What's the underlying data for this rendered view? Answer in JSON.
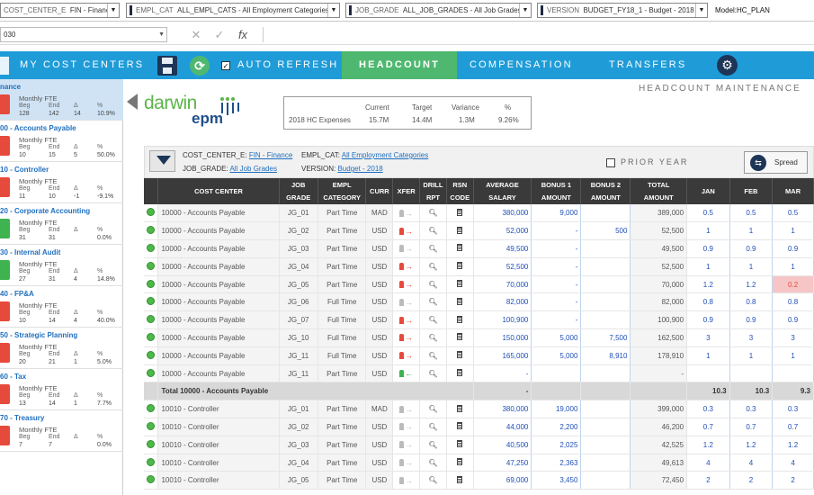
{
  "topbar": {
    "dropdowns": [
      {
        "name": "COST_CENTER_E",
        "value": "FIN - Finance"
      },
      {
        "name": "EMPL_CAT",
        "value": "ALL_EMPL_CATS - All Employment Categories"
      },
      {
        "name": "JOB_GRADE",
        "value": "ALL_JOB_GRADES - All Job Grades"
      },
      {
        "name": "VERSION",
        "value": "BUDGET_FY18_1 - Budget - 2018"
      }
    ],
    "model": "Model:HC_PLAN"
  },
  "formula": {
    "namebox": "030",
    "cancel": "✕",
    "enter": "✓",
    "fx": "fx"
  },
  "nav": {
    "my_cost_centers": "MY COST CENTERS",
    "auto_refresh": "AUTO REFRESH",
    "tabs": [
      "HEADCOUNT",
      "COMPENSATION",
      "TRANSFERS"
    ],
    "active_tab": "HEADCOUNT"
  },
  "sidebar": {
    "items": [
      {
        "title": "nance",
        "beg": "128",
        "end": "142",
        "delta": "14",
        "pct": "10.9%",
        "status": "red",
        "selected": true
      },
      {
        "title": "00 - Accounts Payable",
        "beg": "10",
        "end": "15",
        "delta": "5",
        "pct": "50.0%",
        "status": "red",
        "selected": false
      },
      {
        "title": "10 - Controller",
        "beg": "11",
        "end": "10",
        "delta": "-1",
        "pct": "-9.1%",
        "status": "red",
        "selected": false
      },
      {
        "title": "20 - Corporate Accounting",
        "beg": "31",
        "end": "31",
        "delta": "",
        "pct": "0.0%",
        "status": "green",
        "selected": false
      },
      {
        "title": "30 - Internal Audit",
        "beg": "27",
        "end": "31",
        "delta": "4",
        "pct": "14.8%",
        "status": "green",
        "selected": false
      },
      {
        "title": "40 - FP&A",
        "beg": "10",
        "end": "14",
        "delta": "4",
        "pct": "40.0%",
        "status": "red",
        "selected": false
      },
      {
        "title": "50 - Strategic Planning",
        "beg": "20",
        "end": "21",
        "delta": "1",
        "pct": "5.0%",
        "status": "red",
        "selected": false
      },
      {
        "title": "60 - Tax",
        "beg": "13",
        "end": "14",
        "delta": "1",
        "pct": "7.7%",
        "status": "red",
        "selected": false
      },
      {
        "title": "70 - Treasury",
        "beg": "7",
        "end": "7",
        "delta": "",
        "pct": "0.0%",
        "status": "red",
        "selected": false
      }
    ],
    "label_monthly": "Monthly FTE",
    "col_beg": "Beg",
    "col_end": "End",
    "col_delta": "Δ",
    "col_pct": "%"
  },
  "logo": {
    "line1": "darwin",
    "line2": "epm"
  },
  "hc_summary": {
    "label": "2018 HC Expenses",
    "current_h": "Current",
    "current": "15.7M",
    "target_h": "Target",
    "target": "14.4M",
    "variance_h": "Variance",
    "variance": "1.3M",
    "pct_h": "%",
    "pct": "9.26%"
  },
  "maintenance_title": "HEADCOUNT MAINTENANCE",
  "filters": {
    "cc_label": "COST_CENTER_E:",
    "cc_value": "FIN - Finance",
    "cat_label": "EMPL_CAT:",
    "cat_value": "All Employment Categories",
    "grade_label": "JOB_GRADE:",
    "grade_value": "All Job Grades",
    "ver_label": "VERSION:",
    "ver_value": "Budget - 2018",
    "prior_year": "PRIOR YEAR",
    "spread": "Spread"
  },
  "grid": {
    "headers": [
      {
        "l1": "",
        "l2": "COST CENTER"
      },
      {
        "l1": "JOB",
        "l2": "GRADE"
      },
      {
        "l1": "EMPL",
        "l2": "CATEGORY"
      },
      {
        "l1": "",
        "l2": "CURR"
      },
      {
        "l1": "",
        "l2": "XFER"
      },
      {
        "l1": "DRILL",
        "l2": "RPT"
      },
      {
        "l1": "RSN",
        "l2": "CODE"
      },
      {
        "l1": "AVERAGE",
        "l2": "SALARY"
      },
      {
        "l1": "BONUS 1",
        "l2": "AMOUNT"
      },
      {
        "l1": "BONUS 2",
        "l2": "AMOUNT"
      },
      {
        "l1": "TOTAL",
        "l2": "AMOUNT"
      },
      {
        "l1": "",
        "l2": "JAN"
      },
      {
        "l1": "",
        "l2": "FEB"
      },
      {
        "l1": "",
        "l2": "MAR"
      }
    ],
    "rows": [
      {
        "cc": "10000 - Accounts Payable",
        "grade": "JG_01",
        "cat": "Part Time",
        "curr": "MAD",
        "xfer": "gray",
        "sal": "380,000",
        "b1": "9,000",
        "b2": "",
        "total": "389,000",
        "jan": "0.5",
        "feb": "0.5",
        "mar": "0.5",
        "marflag": ""
      },
      {
        "cc": "10000 - Accounts Payable",
        "grade": "JG_02",
        "cat": "Part Time",
        "curr": "USD",
        "xfer": "red",
        "sal": "52,000",
        "b1": "-",
        "b2": "500",
        "total": "52,500",
        "jan": "1",
        "feb": "1",
        "mar": "1",
        "marflag": ""
      },
      {
        "cc": "10000 - Accounts Payable",
        "grade": "JG_03",
        "cat": "Part Time",
        "curr": "USD",
        "xfer": "gray",
        "sal": "49,500",
        "b1": "-",
        "b2": "",
        "total": "49,500",
        "jan": "0.9",
        "feb": "0.9",
        "mar": "0.9",
        "marflag": ""
      },
      {
        "cc": "10000 - Accounts Payable",
        "grade": "JG_04",
        "cat": "Part Time",
        "curr": "USD",
        "xfer": "red",
        "sal": "52,500",
        "b1": "-",
        "b2": "",
        "total": "52,500",
        "jan": "1",
        "feb": "1",
        "mar": "1",
        "marflag": ""
      },
      {
        "cc": "10000 - Accounts Payable",
        "grade": "JG_05",
        "cat": "Part Time",
        "curr": "USD",
        "xfer": "red",
        "sal": "70,000",
        "b1": "-",
        "b2": "",
        "total": "70,000",
        "jan": "1.2",
        "feb": "1.2",
        "mar": "0.2",
        "marflag": "pink"
      },
      {
        "cc": "10000 - Accounts Payable",
        "grade": "JG_06",
        "cat": "Full Time",
        "curr": "USD",
        "xfer": "gray",
        "sal": "82,000",
        "b1": "-",
        "b2": "",
        "total": "82,000",
        "jan": "0.8",
        "feb": "0.8",
        "mar": "0.8",
        "marflag": ""
      },
      {
        "cc": "10000 - Accounts Payable",
        "grade": "JG_07",
        "cat": "Full Time",
        "curr": "USD",
        "xfer": "red",
        "sal": "100,900",
        "b1": "-",
        "b2": "",
        "total": "100,900",
        "jan": "0.9",
        "feb": "0.9",
        "mar": "0.9",
        "marflag": ""
      },
      {
        "cc": "10000 - Accounts Payable",
        "grade": "JG_10",
        "cat": "Full Time",
        "curr": "USD",
        "xfer": "red",
        "sal": "150,000",
        "b1": "5,000",
        "b2": "7,500",
        "total": "162,500",
        "jan": "3",
        "feb": "3",
        "mar": "3",
        "marflag": ""
      },
      {
        "cc": "10000 - Accounts Payable",
        "grade": "JG_11",
        "cat": "Full Time",
        "curr": "USD",
        "xfer": "red",
        "sal": "165,000",
        "b1": "5,000",
        "b2": "8,910",
        "total": "178,910",
        "jan": "1",
        "feb": "1",
        "mar": "1",
        "marflag": ""
      },
      {
        "cc": "10000 - Accounts Payable",
        "grade": "JG_11",
        "cat": "Part Time",
        "curr": "USD",
        "xfer": "green",
        "sal": "-",
        "b1": "",
        "b2": "",
        "total": "-",
        "jan": "",
        "feb": "",
        "mar": "",
        "marflag": ""
      },
      {
        "total_row": true,
        "cc": "Total 10000 - Accounts Payable",
        "sal": "-",
        "jan": "10.3",
        "feb": "10.3",
        "mar": "9.3"
      },
      {
        "cc": "10010 - Controller",
        "grade": "JG_01",
        "cat": "Part Time",
        "curr": "MAD",
        "xfer": "gray",
        "sal": "380,000",
        "b1": "19,000",
        "b2": "",
        "total": "399,000",
        "jan": "0.3",
        "feb": "0.3",
        "mar": "0.3",
        "marflag": ""
      },
      {
        "cc": "10010 - Controller",
        "grade": "JG_02",
        "cat": "Part Time",
        "curr": "USD",
        "xfer": "gray",
        "sal": "44,000",
        "b1": "2,200",
        "b2": "",
        "total": "46,200",
        "jan": "0.7",
        "feb": "0.7",
        "mar": "0.7",
        "marflag": ""
      },
      {
        "cc": "10010 - Controller",
        "grade": "JG_03",
        "cat": "Part Time",
        "curr": "USD",
        "xfer": "gray",
        "sal": "40,500",
        "b1": "2,025",
        "b2": "",
        "total": "42,525",
        "jan": "1.2",
        "feb": "1.2",
        "mar": "1.2",
        "marflag": ""
      },
      {
        "cc": "10010 - Controller",
        "grade": "JG_04",
        "cat": "Part Time",
        "curr": "USD",
        "xfer": "gray",
        "sal": "47,250",
        "b1": "2,363",
        "b2": "",
        "total": "49,613",
        "jan": "4",
        "feb": "4",
        "mar": "4",
        "marflag": ""
      },
      {
        "cc": "10010 - Controller",
        "grade": "JG_05",
        "cat": "Part Time",
        "curr": "USD",
        "xfer": "gray",
        "sal": "69,000",
        "b1": "3,450",
        "b2": "",
        "total": "72,450",
        "jan": "2",
        "feb": "2",
        "mar": "2",
        "marflag": ""
      }
    ]
  }
}
